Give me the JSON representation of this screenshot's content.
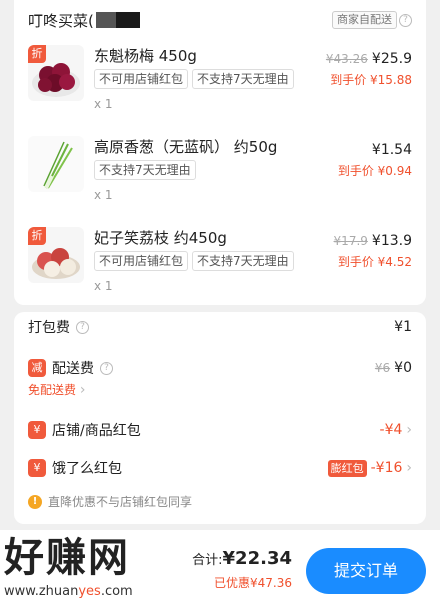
{
  "shop": {
    "name": "叮咚买菜(",
    "delivery_badge": "商家自配送"
  },
  "items": [
    {
      "name": "东魁杨梅 450g",
      "discount_tag": "折",
      "tags": [
        "不可用店铺红包",
        "不支持7天无理由"
      ],
      "qty": "x 1",
      "original_price": "¥43.26",
      "price": "¥25.9",
      "final_price": "到手价 ¥15.88"
    },
    {
      "name": "高原香葱（无蓝矾） 约50g",
      "discount_tag": "",
      "tags": [
        "不支持7天无理由"
      ],
      "qty": "x 1",
      "original_price": "",
      "price": "¥1.54",
      "final_price": "到手价 ¥0.94"
    },
    {
      "name": "妃子笑荔枝 约450g",
      "discount_tag": "折",
      "tags": [
        "不可用店铺红包",
        "不支持7天无理由"
      ],
      "qty": "x 1",
      "original_price": "¥17.9",
      "price": "¥13.9",
      "final_price": "到手价 ¥4.52"
    }
  ],
  "fees": {
    "packing_label": "打包费",
    "packing_value": "¥1",
    "delivery_icon": "减",
    "delivery_label": "配送费",
    "delivery_original": "¥6",
    "delivery_value": "¥0",
    "free_delivery_link": "免配送费",
    "shop_hongbao_icon": "¥",
    "shop_hongbao_label": "店铺/商品红包",
    "shop_hongbao_value": "-¥4",
    "eleme_hongbao_icon": "¥",
    "eleme_hongbao_label": "饿了么红包",
    "eleme_hongbao_badge": "膨红包",
    "eleme_hongbao_value": "-¥16",
    "note_icon": "!",
    "note_text": "直降优惠不与店铺红包同享"
  },
  "bottom": {
    "total_label": "合计:",
    "total_value": "¥22.34",
    "saved": "已优惠¥47.36",
    "submit_label": "提交订单"
  },
  "watermark": {
    "big": "好赚网",
    "small_prefix": "www.zhuan",
    "small_highlight": "yes",
    "small_suffix": ".com"
  },
  "colors": {
    "accent_red": "#f0502d",
    "submit_blue": "#1a8cff"
  }
}
